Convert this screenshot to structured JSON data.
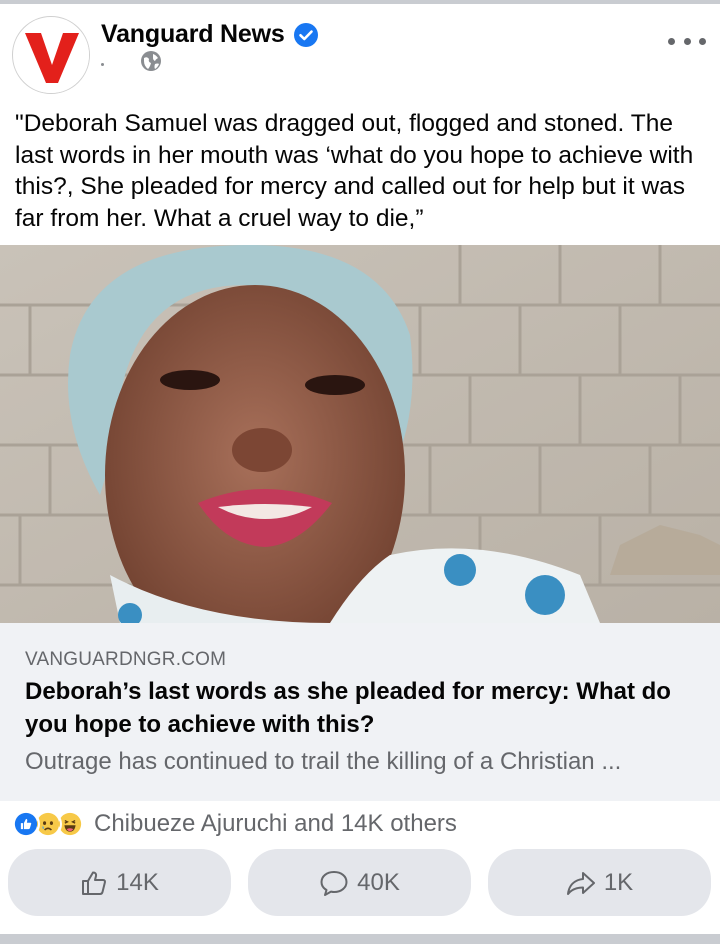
{
  "post": {
    "page_name": "Vanguard News",
    "verified": true,
    "caption": "\"Deborah Samuel was dragged out, flogged and stoned. The last words in her mouth was ‘what do you hope to achieve with this?, She pleaded for mercy and called out for help but it was far from her. What a cruel way to die,”",
    "photo_icon": "portrait-photo"
  },
  "link_preview": {
    "domain": "VANGUARDNGR.COM",
    "title": "Deborah’s last words as she pleaded for mercy: What do you hope to achieve with this?",
    "description": "Outrage has continued to trail the killing of a Christian ..."
  },
  "reactions": {
    "summary": "Chibueze Ajuruchi and 14K others",
    "icons": [
      "like-icon",
      "sad-icon",
      "haha-icon"
    ]
  },
  "actions": {
    "like_count": "14K",
    "comment_count": "40K",
    "share_count": "1K"
  },
  "colors": {
    "verified_blue": "#1877f2",
    "brand_red": "#e3201b",
    "muted_text": "#65676b",
    "button_bg": "#e4e6eb"
  }
}
